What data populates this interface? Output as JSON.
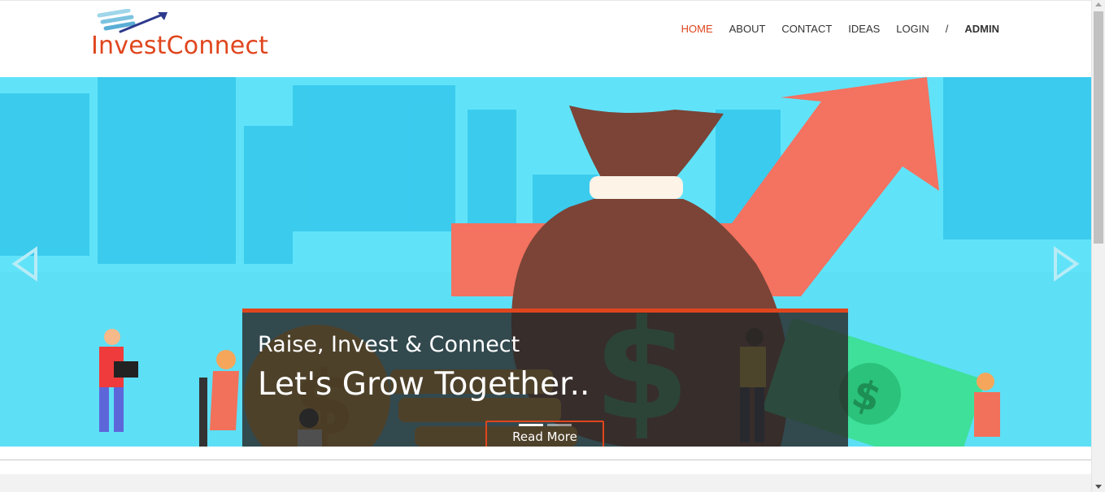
{
  "brand": {
    "name": "InvestConnect",
    "color": "#e0461e"
  },
  "nav": {
    "items": [
      "HOME",
      "ABOUT",
      "CONTACT",
      "IDEAS",
      "LOGIN"
    ],
    "separator": "/",
    "admin": "ADMIN",
    "active": "HOME"
  },
  "hero": {
    "subtitle": "Raise, Invest & Connect",
    "title": "Let's Grow Together..",
    "button_label": "Read More",
    "prev_icon": "chevron-left-icon",
    "next_icon": "chevron-right-icon",
    "slide_count": 2,
    "active_slide": 1,
    "background_color": "#60e3f9"
  }
}
